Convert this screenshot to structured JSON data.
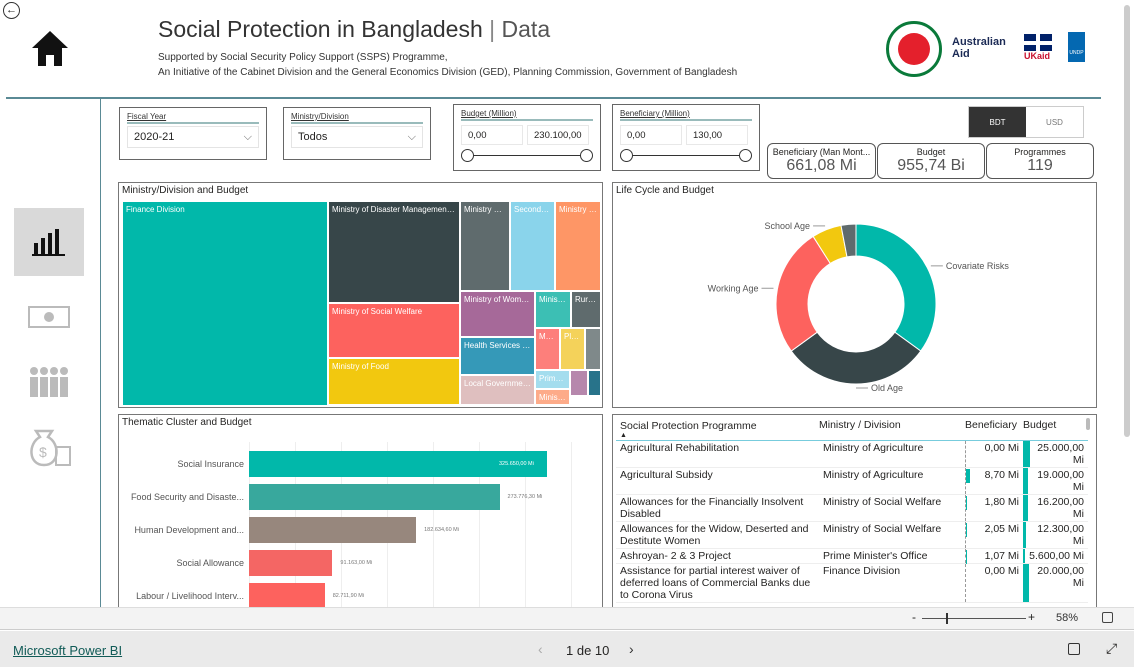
{
  "header": {
    "title": "Social Protection in Bangladesh",
    "title_sep": "|",
    "title_suffix": "Data",
    "line1": "Supported by Social Security Policy Support (SSPS) Programme,",
    "line2": "An Initiative of the Cabinet Division and the General Economics Division (GED), Planning Commission, Government of Bangladesh",
    "logos": {
      "australian_aid": "Australian Aid",
      "ukaid": "UKaid",
      "undp": "UNDP"
    }
  },
  "filters": {
    "fiscal_year": {
      "label": "Fiscal Year",
      "value": "2020-21"
    },
    "ministry": {
      "label": "Ministry/Division",
      "value": "Todos"
    },
    "budget": {
      "label": "Budget (Million)",
      "min": "0,00",
      "max": "230.100,00"
    },
    "beneficiary": {
      "label": "Beneficiary (Million)",
      "min": "0,00",
      "max": "130,00"
    }
  },
  "currency": {
    "bdt": "BDT",
    "usd": "USD",
    "selected": "BDT"
  },
  "cards": [
    {
      "label": "Beneficiary (Man Mont...",
      "value": "661,08 Mi"
    },
    {
      "label": "Budget",
      "value": "955,74 Bi"
    },
    {
      "label": "Programmes",
      "value": "119"
    }
  ],
  "treemap": {
    "title": "Ministry/Division and Budget",
    "items": [
      {
        "label": "Finance Division",
        "color": "#01B8AA"
      },
      {
        "label": "Ministry of Disaster Management ...",
        "color": "#374649"
      },
      {
        "label": "Ministry of Social Welfare",
        "color": "#FD625E"
      },
      {
        "label": "Ministry of Food",
        "color": "#F2C80F"
      },
      {
        "label": "Ministry of ...",
        "color": "#5F6B6D"
      },
      {
        "label": "Secondar...",
        "color": "#8AD4EB"
      },
      {
        "label": "Ministry o...",
        "color": "#FE9666"
      },
      {
        "label": "Ministry of Wome...",
        "color": "#A66999"
      },
      {
        "label": "Ministr...",
        "color": "#3CBFB4"
      },
      {
        "label": "Rural...",
        "color": "#5F6B6D"
      },
      {
        "label": "Health Services Di...",
        "color": "#3599B8"
      },
      {
        "label": "Local Government ...",
        "color": "#DFBFBF"
      },
      {
        "label": "Me...",
        "color": "#FD7F7B"
      },
      {
        "label": "Pla...",
        "color": "#F4D25A"
      },
      {
        "label": "",
        "color": "#7F898A"
      },
      {
        "label": "Prime ...",
        "color": "#A4DDEE"
      },
      {
        "label": "Ministr...",
        "color": "#FDAB89"
      },
      {
        "label": "",
        "color": "#B687AC"
      },
      {
        "label": "",
        "color": "#28738A"
      }
    ]
  },
  "lifecycle": {
    "title": "Life Cycle and Budget",
    "slices": [
      {
        "label": "Covariate Risks",
        "value": 35,
        "color": "#01B8AA"
      },
      {
        "label": "Old Age",
        "value": 30,
        "color": "#374649"
      },
      {
        "label": "Working Age",
        "value": 26,
        "color": "#FD625E"
      },
      {
        "label": "School Age",
        "value": 6,
        "color": "#F2C80F"
      },
      {
        "label": "",
        "value": 3,
        "color": "#5F6B6D"
      }
    ]
  },
  "thematic": {
    "title": "Thematic Cluster and Budget",
    "bars": [
      {
        "label": "Social Insurance",
        "value": 325650,
        "text": "325.650,00 Mi",
        "color": "#01B8AA"
      },
      {
        "label": "Food Security and Disaste...",
        "value": 273776.3,
        "text": "273.776,30 Mi",
        "color": "#38A89D"
      },
      {
        "label": "Human Development and...",
        "value": 182634.6,
        "text": "182.634,60 Mi",
        "color": "#97877D"
      },
      {
        "label": "Social Allowance",
        "value": 91163,
        "text": "91.163,00 Mi",
        "color": "#F46664"
      },
      {
        "label": "Labour / Livelihood Interv...",
        "value": 82711.9,
        "text": "82.711,90 Mi",
        "color": "#FD625E"
      }
    ]
  },
  "table": {
    "headers": [
      "Social Protection Programme",
      "Ministry / Division",
      "Beneficiary",
      "Budget"
    ],
    "rows": [
      {
        "programme": "Agricultural Rehabilitation",
        "ministry": "Ministry of Agriculture",
        "beneficiary": "0,00 Mi",
        "ben": 0,
        "budget": "25.000,00 Mi",
        "bud": 25000
      },
      {
        "programme": "Agricultural Subsidy",
        "ministry": "Ministry of Agriculture",
        "beneficiary": "8,70 Mi",
        "ben": 8.7,
        "budget": "19.000,00 Mi",
        "bud": 19000
      },
      {
        "programme": "Allowances for the Financially Insolvent Disabled",
        "ministry": "Ministry of Social Welfare",
        "beneficiary": "1,80 Mi",
        "ben": 1.8,
        "budget": "16.200,00 Mi",
        "bud": 16200
      },
      {
        "programme": "Allowances for the Widow, Deserted and Destitute Women",
        "ministry": "Ministry of Social Welfare",
        "beneficiary": "2,05 Mi",
        "ben": 2.05,
        "budget": "12.300,00 Mi",
        "bud": 12300
      },
      {
        "programme": "Ashroyan- 2 & 3 Project",
        "ministry": "Prime Minister's Office",
        "beneficiary": "1,07 Mi",
        "ben": 1.07,
        "budget": "5.600,00 Mi",
        "bud": 5600
      },
      {
        "programme": "Assistance for partial interest waiver of deferred loans of Commercial Banks due to Corona Virus",
        "ministry": "Finance Division",
        "beneficiary": "0,00 Mi",
        "ben": 0,
        "budget": "20.000,00 Mi",
        "bud": 20000
      }
    ]
  },
  "footer": {
    "zoom": "58%",
    "brand": "Microsoft Power BI",
    "page": "1 de 10"
  }
}
